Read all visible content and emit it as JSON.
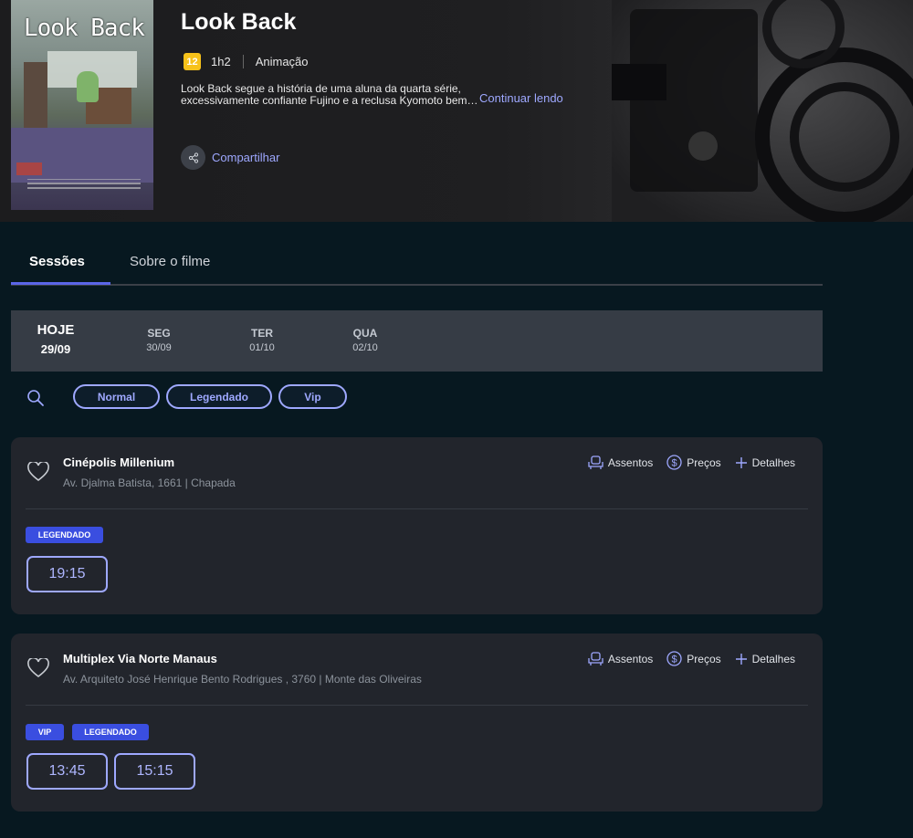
{
  "movie": {
    "poster_title": "Look Back",
    "title": "Look Back",
    "rating": "12",
    "duration": "1h2",
    "genre": "Animação",
    "synopsis": "Look Back segue a história de uma aluna da quarta série, excessivamente confiante Fujino e a reclusa Kyomoto bem…",
    "read_more": "Continuar lendo",
    "share": "Compartilhar",
    "rating_color": "#f7c21a"
  },
  "tabs": [
    "Sessões",
    "Sobre o filme"
  ],
  "dates": [
    {
      "day": "HOJE",
      "date": "29/09"
    },
    {
      "day": "SEG",
      "date": "30/09"
    },
    {
      "day": "TER",
      "date": "01/10"
    },
    {
      "day": "QUA",
      "date": "02/10"
    }
  ],
  "filters": [
    "Normal",
    "Legendado",
    "Vip"
  ],
  "actions": {
    "seats": "Assentos",
    "prices": "Preços",
    "details": "Detalhes"
  },
  "cinemas": [
    {
      "name": "Cinépolis Millenium",
      "address": "Av. Djalma Batista, 1661 | Chapada",
      "tags": [
        "LEGENDADO"
      ],
      "times": [
        "19:15"
      ]
    },
    {
      "name": "Multiplex Via Norte Manaus",
      "address": "Av. Arquiteto José Henrique Bento Rodrigues , 3760 | Monte das Oliveiras",
      "tags": [
        "VIP",
        "LEGENDADO"
      ],
      "times": [
        "13:45",
        "15:15"
      ]
    }
  ],
  "accent_color": "#9ea8ff",
  "tag_color": "#3a4ee0"
}
